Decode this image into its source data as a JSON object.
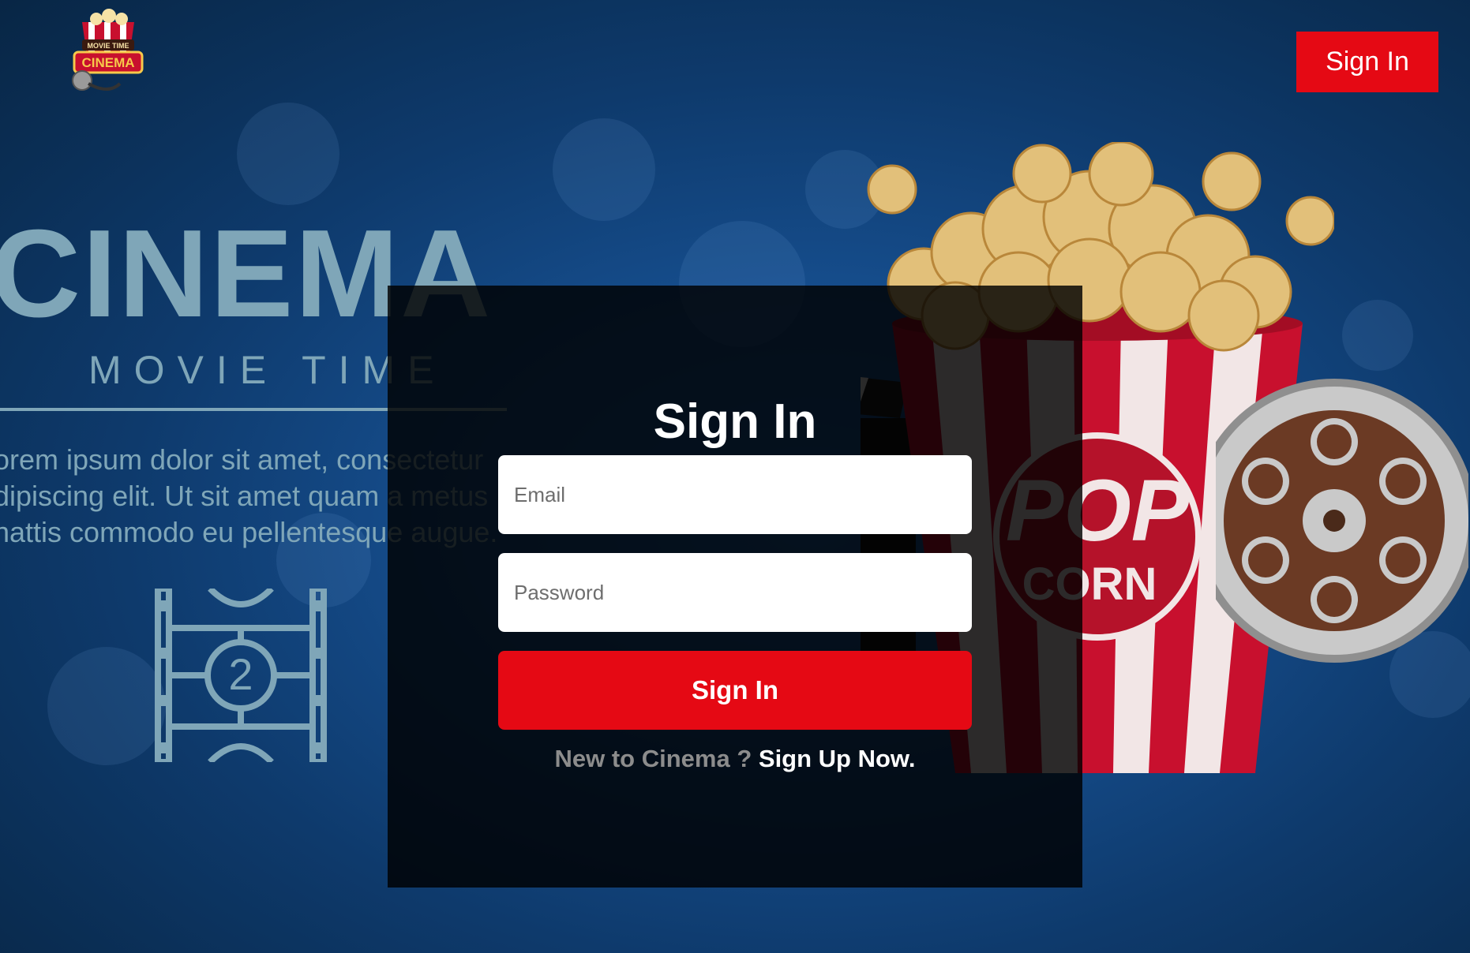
{
  "header": {
    "logo_text_top": "MOVIE TIME",
    "logo_text_main": "CINEMA",
    "signin_label": "Sign In"
  },
  "hero": {
    "title": "CINEMA",
    "subtitle": "MOVIE TIME",
    "lorem_lines": [
      "orem ipsum dolor sit amet, consectetur",
      "dipiscing elit. Ut sit amet quam a metus",
      "nattis commodo eu pellentesque augue."
    ],
    "countdown_number": "2",
    "popcorn_text_top": "POP",
    "popcorn_text_bottom": "CORN"
  },
  "form": {
    "title": "Sign In",
    "email_placeholder": "Email",
    "password_placeholder": "Password",
    "submit_label": "Sign In",
    "signup_prompt": "New to Cinema ?",
    "signup_link": "Sign Up Now."
  },
  "colors": {
    "accent": "#e50914",
    "background": "#164e8e",
    "panel": "#000000"
  },
  "icons": {
    "logo": "cinema-logo-icon",
    "popcorn": "popcorn-bucket-icon",
    "reel": "film-reel-icon",
    "filmstrip": "countdown-filmstrip-icon"
  }
}
